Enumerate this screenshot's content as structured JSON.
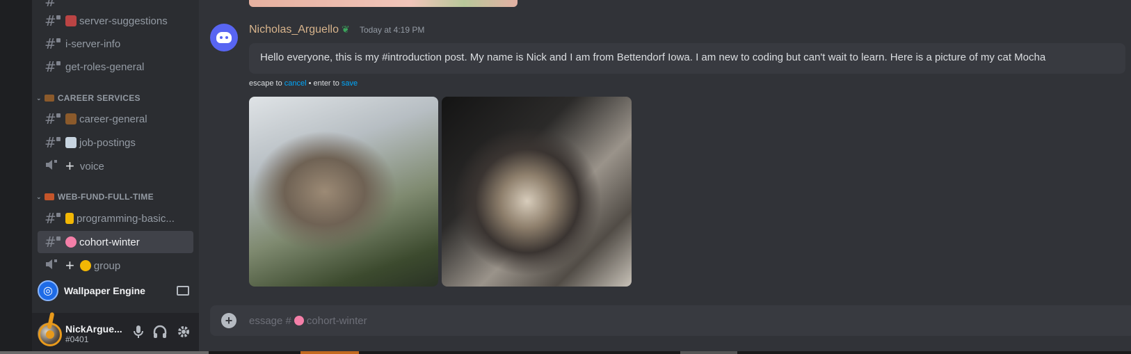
{
  "sidebar": {
    "channels_top": [
      {
        "name": "server-suggestions",
        "emoji_color": "#b44"
      },
      {
        "name": "i-server-info",
        "emoji_color": ""
      },
      {
        "name": "get-roles-general",
        "emoji_color": ""
      }
    ],
    "categories": [
      {
        "label": "CAREER SERVICES",
        "color": "#8b5a2b"
      },
      {
        "label": "WEB-FUND-FULL-TIME",
        "color": "#c4552a"
      }
    ],
    "career_channels": [
      {
        "name": "career-general",
        "emoji_color": "#8b5a2b"
      },
      {
        "name": "job-postings",
        "emoji_color": "#c7d4e0"
      },
      {
        "name": "voice"
      }
    ],
    "web_channels": [
      {
        "name": "programming-basic...",
        "emoji_color": "#f2b705"
      },
      {
        "name": "cohort-winter",
        "emoji_color": "#f47fa8"
      },
      {
        "name": "group",
        "emoji_color": "#f2b705"
      }
    ]
  },
  "activity": {
    "name": "Wallpaper Engine"
  },
  "user": {
    "name": "NickArgue...",
    "tag": "#0401"
  },
  "message": {
    "author": "Nicholas_Arguello",
    "timestamp": "Today at 4:19 PM",
    "text": "Hello everyone, this is my #introduction post. My name is Nick and I am from Bettendorf Iowa. I am new to coding but can't wait to learn.  Here is a picture of my cat Mocha",
    "hint_prefix": "escape to ",
    "hint_cancel": "cancel",
    "hint_mid": " • enter to ",
    "hint_save": "save"
  },
  "composer": {
    "prefix": "essage #",
    "channel": "cohort-winter"
  },
  "colors": {
    "accent": "#00a8fc",
    "brand": "#5865f2",
    "cursor": "#e89a1c"
  }
}
